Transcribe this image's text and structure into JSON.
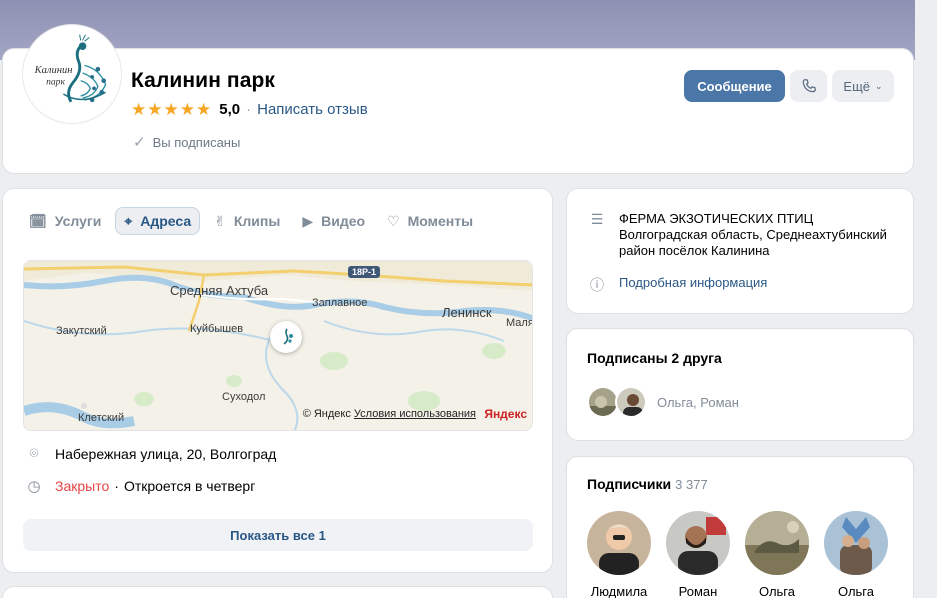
{
  "profile": {
    "logo_text": "Калинин парк",
    "name": "Калинин парк",
    "rating_value": "5,0",
    "rating_stars": 5,
    "write_review": "Написать отзыв",
    "subscribed": "Вы подписаны"
  },
  "actions": {
    "message": "Сообщение",
    "more": "Ещё"
  },
  "tabs": [
    {
      "label": "Услуги",
      "icon": "services-icon"
    },
    {
      "label": "Адреса",
      "icon": "location-icon",
      "active": true
    },
    {
      "label": "Клипы",
      "icon": "clips-icon"
    },
    {
      "label": "Видео",
      "icon": "video-icon"
    },
    {
      "label": "Моменты",
      "icon": "moments-icon"
    }
  ],
  "map": {
    "road_badge": "18Р-1",
    "labels": {
      "srednyaya": "Средняя Ахтуба",
      "zaplavnoe": "Заплавное",
      "leninsk": "Ленинск",
      "malya": "Маля",
      "zakutskiy": "Закутский",
      "kuybyshev": "Куйбышев",
      "sukhodol": "Суходол",
      "kletskiy": "Клетский"
    },
    "copyright": "© Яндекс",
    "terms": "Условия использования",
    "brand": "Яндекс"
  },
  "location": {
    "address": "Набережная улица, 20, Волгоград",
    "status": "Закрыто",
    "opens": "Откроется в четверг",
    "show_all": "Показать все 1"
  },
  "about": {
    "description": "ФЕРМА ЭКЗОТИЧЕСКИХ ПТИЦ Волгоградская область, Среднеахтубинский район посёлок Калинина",
    "more_info": "Подробная информация"
  },
  "friends": {
    "title": "Подписаны 2 друга",
    "names": "Ольга, Роман"
  },
  "subscribers": {
    "title": "Подписчики",
    "count": "3 377",
    "items": [
      {
        "name": "Людмила"
      },
      {
        "name": "Роман"
      },
      {
        "name": "Ольга"
      },
      {
        "name": "Ольга"
      }
    ]
  },
  "colors": {
    "accent": "#4a76a8",
    "link": "#2a5885",
    "star": "#f5a623",
    "closed": "#e64646"
  }
}
